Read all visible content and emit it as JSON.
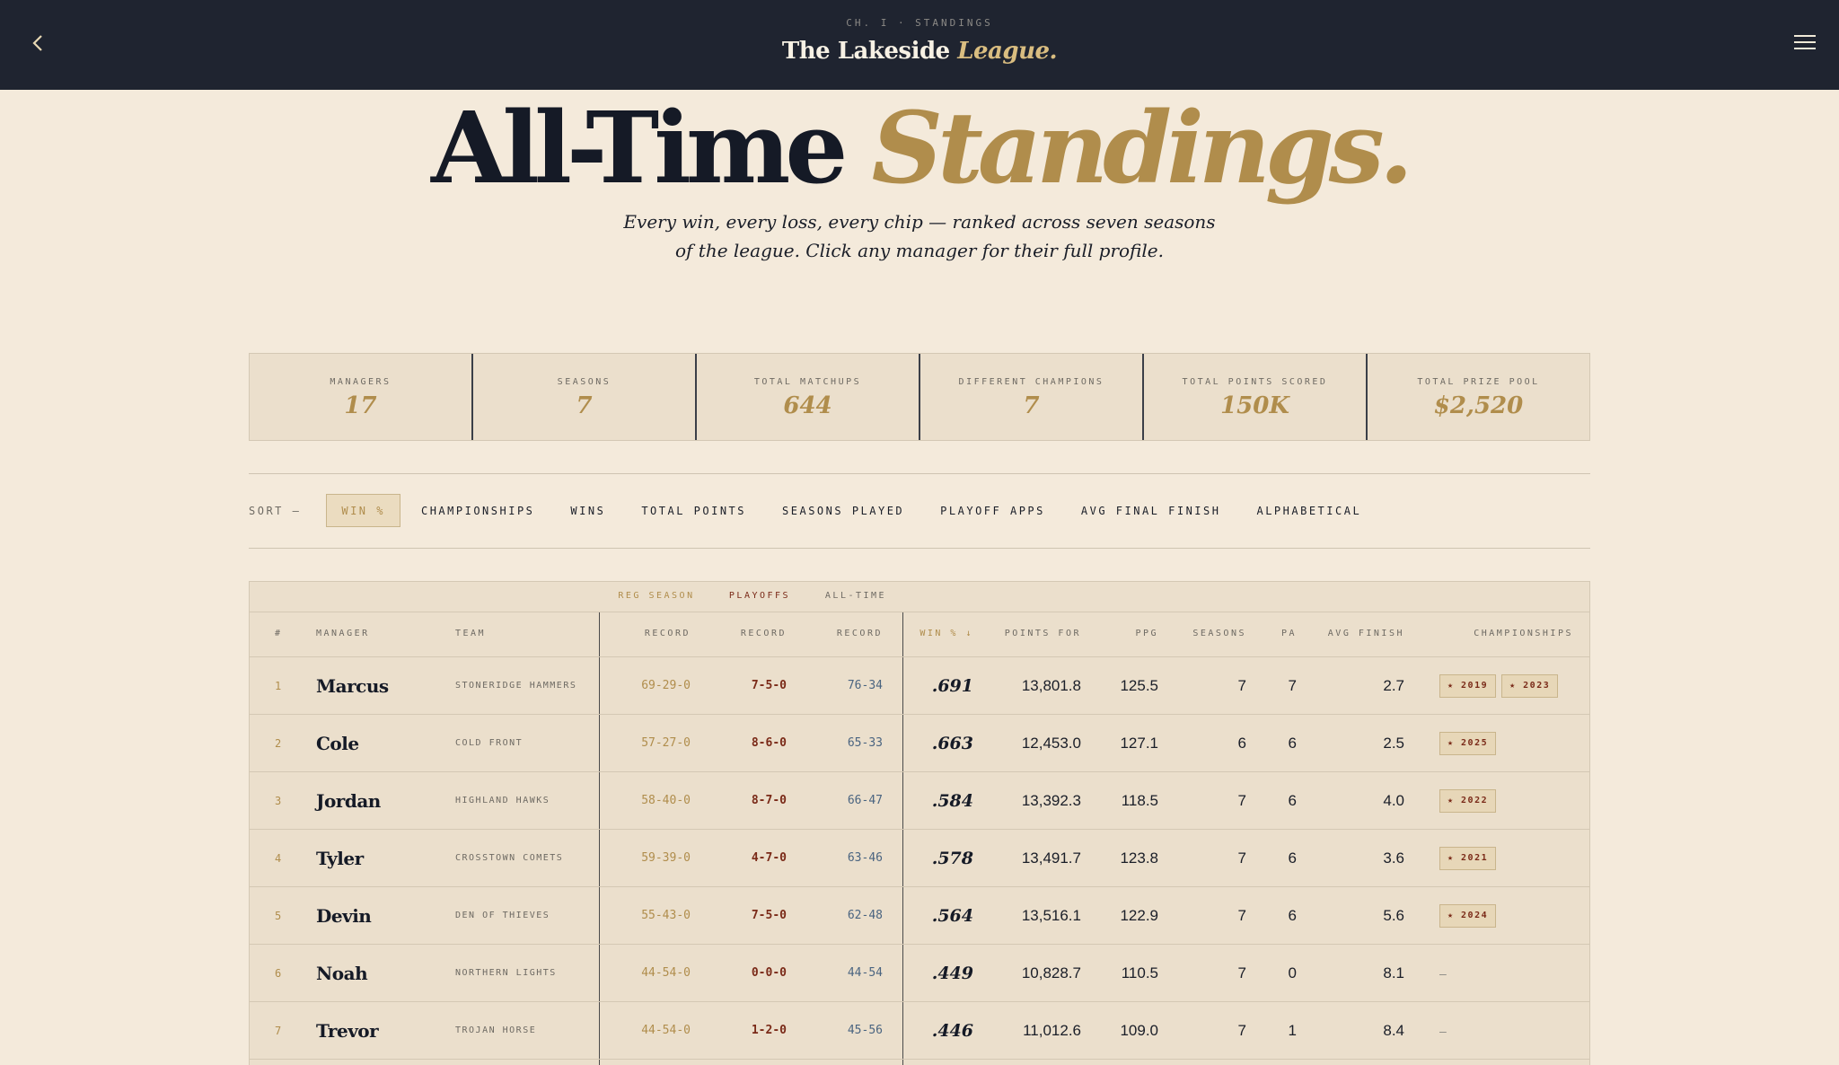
{
  "header": {
    "eyebrow": "CH. I · STANDINGS",
    "brand_main": "The Lakeside",
    "brand_accent": "League."
  },
  "hero": {
    "title_main": "All-Time",
    "title_accent": "Standings.",
    "subtitle_line1": "Every win, every loss, every chip — ranked across seven seasons",
    "subtitle_line2": "of the league. Click any manager for their full profile."
  },
  "stats": [
    {
      "label": "MANAGERS",
      "value": "17"
    },
    {
      "label": "SEASONS",
      "value": "7"
    },
    {
      "label": "TOTAL MATCHUPS",
      "value": "644"
    },
    {
      "label": "DIFFERENT CHAMPIONS",
      "value": "7"
    },
    {
      "label": "TOTAL POINTS SCORED",
      "value": "150K"
    },
    {
      "label": "TOTAL PRIZE POOL",
      "value": "$2,520"
    }
  ],
  "sort": {
    "label": "SORT —",
    "options": [
      "WIN %",
      "CHAMPIONSHIPS",
      "WINS",
      "TOTAL POINTS",
      "SEASONS PLAYED",
      "PLAYOFF APPS",
      "AVG FINAL FINISH",
      "ALPHABETICAL"
    ],
    "active": "WIN %"
  },
  "table": {
    "groups": {
      "reg": "REG SEASON",
      "playoffs": "PLAYOFFS",
      "all": "ALL-TIME"
    },
    "headers": {
      "rank": "#",
      "manager": "MANAGER",
      "team": "TEAM",
      "rec_reg": "RECORD",
      "rec_po": "RECORD",
      "rec_all": "RECORD",
      "winpct": "WIN % ↓",
      "pf": "POINTS FOR",
      "ppg": "PPG",
      "seasons": "SEASONS",
      "pa": "PA",
      "avg": "AVG FINISH",
      "champs": "CHAMPIONSHIPS"
    },
    "rows": [
      {
        "rank": "1",
        "manager": "Marcus",
        "team": "STONERIDGE HAMMERS",
        "reg": "69-29-0",
        "po": "7-5-0",
        "all": "76-34",
        "winpct": ".691",
        "pf": "13,801.8",
        "ppg": "125.5",
        "seasons": "7",
        "pa": "7",
        "avg": "2.7",
        "champs": [
          "★ 2019",
          "★ 2023"
        ]
      },
      {
        "rank": "2",
        "manager": "Cole",
        "team": "COLD FRONT",
        "reg": "57-27-0",
        "po": "8-6-0",
        "all": "65-33",
        "winpct": ".663",
        "pf": "12,453.0",
        "ppg": "127.1",
        "seasons": "6",
        "pa": "6",
        "avg": "2.5",
        "champs": [
          "★ 2025"
        ]
      },
      {
        "rank": "3",
        "manager": "Jordan",
        "team": "HIGHLAND HAWKS",
        "reg": "58-40-0",
        "po": "8-7-0",
        "all": "66-47",
        "winpct": ".584",
        "pf": "13,392.3",
        "ppg": "118.5",
        "seasons": "7",
        "pa": "6",
        "avg": "4.0",
        "champs": [
          "★ 2022"
        ]
      },
      {
        "rank": "4",
        "manager": "Tyler",
        "team": "CROSSTOWN COMETS",
        "reg": "59-39-0",
        "po": "4-7-0",
        "all": "63-46",
        "winpct": ".578",
        "pf": "13,491.7",
        "ppg": "123.8",
        "seasons": "7",
        "pa": "6",
        "avg": "3.6",
        "champs": [
          "★ 2021"
        ]
      },
      {
        "rank": "5",
        "manager": "Devin",
        "team": "DEN OF THIEVES",
        "reg": "55-43-0",
        "po": "7-5-0",
        "all": "62-48",
        "winpct": ".564",
        "pf": "13,516.1",
        "ppg": "122.9",
        "seasons": "7",
        "pa": "6",
        "avg": "5.6",
        "champs": [
          "★ 2024"
        ]
      },
      {
        "rank": "6",
        "manager": "Noah",
        "team": "NORTHERN LIGHTS",
        "reg": "44-54-0",
        "po": "0-0-0",
        "all": "44-54",
        "winpct": ".449",
        "pf": "10,828.7",
        "ppg": "110.5",
        "seasons": "7",
        "pa": "0",
        "avg": "8.1",
        "champs": []
      },
      {
        "rank": "7",
        "manager": "Trevor",
        "team": "TROJAN HORSE",
        "reg": "44-54-0",
        "po": "1-2-0",
        "all": "45-56",
        "winpct": ".446",
        "pf": "11,012.6",
        "ppg": "109.0",
        "seasons": "7",
        "pa": "1",
        "avg": "8.4",
        "champs": []
      }
    ],
    "empty_champ": "–"
  },
  "colors": {
    "gold": "#b08d4c",
    "navy": "#1f2430",
    "cream": "#f4eadb",
    "rust": "#7a2a18",
    "slate": "#4a6480"
  }
}
